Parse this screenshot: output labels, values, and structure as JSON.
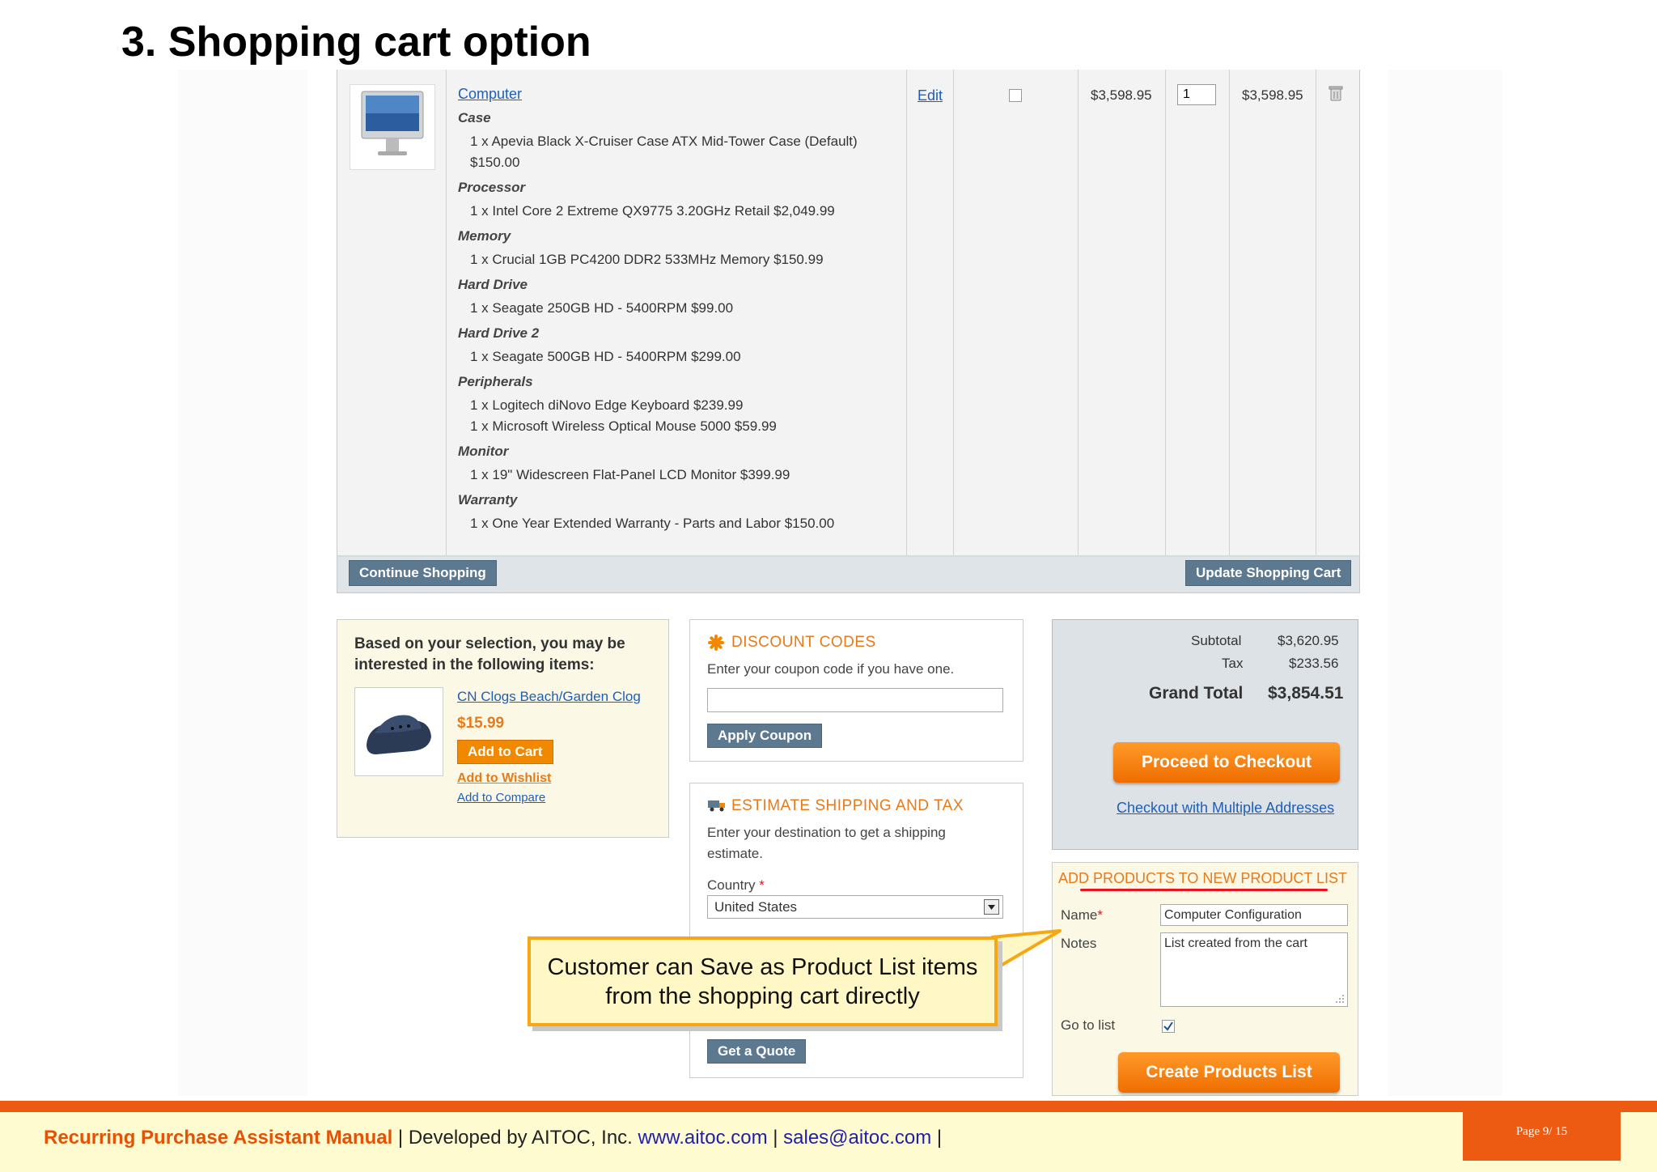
{
  "page_title": "3. Shopping cart option",
  "cart": {
    "product_name": "Computer",
    "edit_label": "Edit",
    "unit_price": "$3,598.95",
    "qty": "1",
    "row_subtotal": "$3,598.95",
    "options": [
      {
        "label": "Case",
        "values": [
          "1 x Apevia Black X-Cruiser Case ATX Mid-Tower Case (Default)",
          "$150.00"
        ]
      },
      {
        "label": "Processor",
        "values": [
          "1 x Intel Core 2 Extreme QX9775 3.20GHz Retail $2,049.99"
        ]
      },
      {
        "label": "Memory",
        "values": [
          "1 x Crucial 1GB PC4200 DDR2 533MHz Memory $150.99"
        ]
      },
      {
        "label": "Hard Drive",
        "values": [
          "1 x Seagate 250GB HD - 5400RPM $99.00"
        ]
      },
      {
        "label": "Hard Drive 2",
        "values": [
          "1 x Seagate 500GB HD - 5400RPM $299.00"
        ]
      },
      {
        "label": "Peripherals",
        "values": [
          "1 x Logitech diNovo Edge Keyboard $239.99",
          "1 x Microsoft Wireless Optical Mouse 5000 $59.99"
        ]
      },
      {
        "label": "Monitor",
        "values": [
          "1 x 19\" Widescreen Flat-Panel LCD Monitor $399.99"
        ]
      },
      {
        "label": "Warranty",
        "values": [
          "1 x One Year Extended Warranty - Parts and Labor $150.00"
        ]
      }
    ],
    "continue_label": "Continue Shopping",
    "update_label": "Update Shopping Cart"
  },
  "crosssell": {
    "title": "Based on your selection, you may be interested in the following items:",
    "item_name": "CN Clogs Beach/Garden Clog",
    "price": "$15.99",
    "add_to_cart": "Add to Cart",
    "add_to_wishlist": "Add to Wishlist",
    "add_to_compare": "Add to Compare"
  },
  "discount": {
    "title": "DISCOUNT CODES",
    "hint": "Enter your coupon code if you have one.",
    "code_value": "",
    "apply_label": "Apply Coupon"
  },
  "shipping": {
    "title": "ESTIMATE SHIPPING AND TAX",
    "hint": "Enter your destination to get a shipping estimate.",
    "country_label": "Country",
    "required_mark": "*",
    "country_value": "United States",
    "quote_label": "Get a Quote"
  },
  "totals": {
    "subtotal_label": "Subtotal",
    "subtotal_value": "$3,620.95",
    "tax_label": "Tax",
    "tax_value": "$233.56",
    "grand_label": "Grand Total",
    "grand_value": "$3,854.51",
    "checkout_label": "Proceed to Checkout",
    "multi_label": "Checkout with Multiple Addresses"
  },
  "product_list": {
    "title": "ADD PRODUCTS TO NEW PRODUCT LIST",
    "name_label": "Name",
    "required_mark": "*",
    "name_value": "Computer Configuration",
    "notes_label": "Notes",
    "notes_value": "List created from the cart",
    "goto_label": "Go to list",
    "goto_checked": true,
    "create_label": "Create Products List"
  },
  "callout": {
    "line1": "Customer can Save as Product List items",
    "line2": "from the shopping cart directly"
  },
  "footer": {
    "brand": "Recurring Purchase Assistant Manual",
    "sep1": " | Developed by AITOC, Inc. ",
    "website": "www.aitoc.com",
    "sep2": " | ",
    "email": "sales@aitoc.com",
    "sep3": " |",
    "page": "Page 9/ 15"
  },
  "colors": {
    "accent_orange": "#ed5a12",
    "section_orange": "#e87a1a",
    "button_blue": "#5d7990",
    "link_blue": "#1e5fb5",
    "highlight_red": "#e8131f"
  }
}
